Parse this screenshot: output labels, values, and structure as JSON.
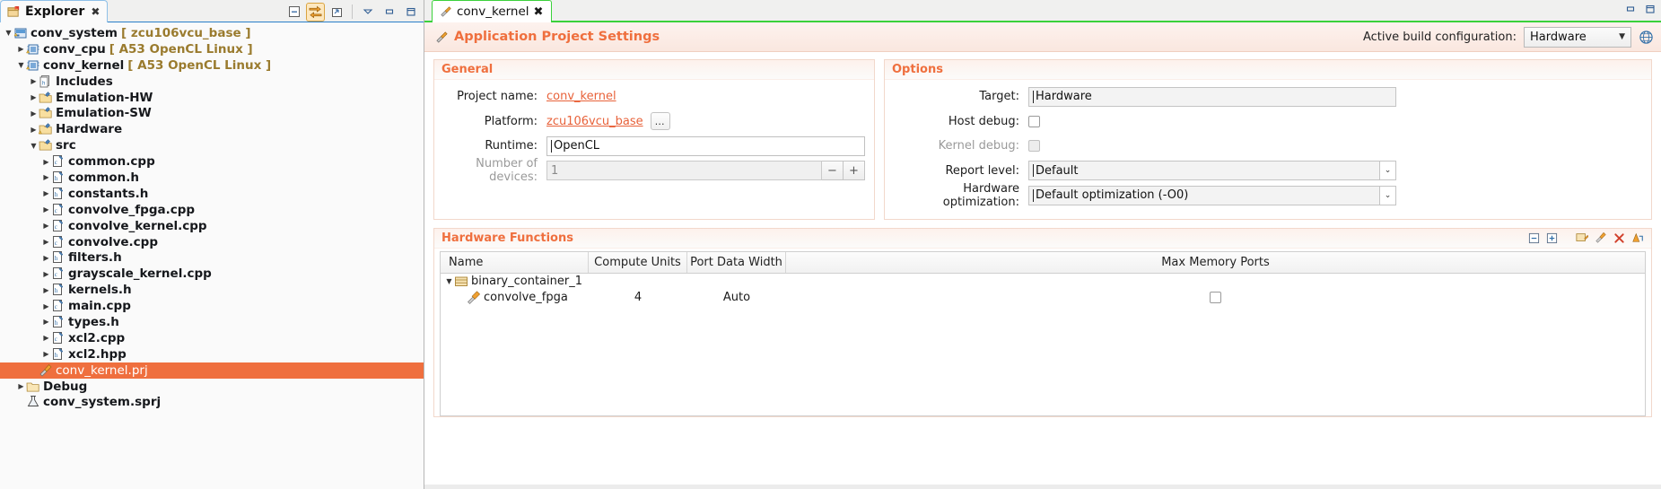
{
  "explorer": {
    "tab_label": "Explorer",
    "tab_close": "✖",
    "toolbar": [
      {
        "name": "collapse-all-icon",
        "glyph": "⊟"
      },
      {
        "name": "link-with-editor-icon",
        "glyph": "⇆"
      },
      {
        "name": "restore-icon",
        "glyph": "⇱"
      },
      {
        "name": "view-menu-icon",
        "glyph": "▽"
      },
      {
        "name": "minimize-icon",
        "glyph": "▭"
      },
      {
        "name": "maximize-icon",
        "glyph": "❐"
      }
    ],
    "tree": [
      {
        "indent": 0,
        "arrow": "▼",
        "icon": "system-project-icon",
        "name": "conv_system",
        "meta": "[ zcu106vcu_base ]",
        "selected": false
      },
      {
        "indent": 1,
        "arrow": "▶",
        "icon": "cpu-project-icon",
        "name": "conv_cpu",
        "meta": "[ A53 OpenCL Linux ]",
        "selected": false
      },
      {
        "indent": 1,
        "arrow": "▼",
        "icon": "cpu-project-icon",
        "name": "conv_kernel",
        "meta": "[ A53 OpenCL Linux ]",
        "selected": false
      },
      {
        "indent": 2,
        "arrow": "▶",
        "icon": "includes-icon",
        "name": "Includes",
        "meta": "",
        "selected": false
      },
      {
        "indent": 2,
        "arrow": "▶",
        "icon": "folder-build-icon",
        "name": "Emulation-HW",
        "meta": "",
        "selected": false
      },
      {
        "indent": 2,
        "arrow": "▶",
        "icon": "folder-build-icon",
        "name": "Emulation-SW",
        "meta": "",
        "selected": false
      },
      {
        "indent": 2,
        "arrow": "▶",
        "icon": "folder-build-warning-icon",
        "name": "Hardware",
        "meta": "",
        "selected": false
      },
      {
        "indent": 2,
        "arrow": "▼",
        "icon": "folder-src-icon",
        "name": "src",
        "meta": "",
        "selected": false
      },
      {
        "indent": 3,
        "arrow": "▶",
        "icon": "cpp-file-icon",
        "name": "common.cpp",
        "meta": "",
        "selected": false
      },
      {
        "indent": 3,
        "arrow": "▶",
        "icon": "h-file-icon",
        "name": "common.h",
        "meta": "",
        "selected": false
      },
      {
        "indent": 3,
        "arrow": "▶",
        "icon": "h-file-icon",
        "name": "constants.h",
        "meta": "",
        "selected": false
      },
      {
        "indent": 3,
        "arrow": "▶",
        "icon": "cpp-file-icon",
        "name": "convolve_fpga.cpp",
        "meta": "",
        "selected": false
      },
      {
        "indent": 3,
        "arrow": "▶",
        "icon": "cpp-file-icon",
        "name": "convolve_kernel.cpp",
        "meta": "",
        "selected": false
      },
      {
        "indent": 3,
        "arrow": "▶",
        "icon": "cpp-file-icon",
        "name": "convolve.cpp",
        "meta": "",
        "selected": false
      },
      {
        "indent": 3,
        "arrow": "▶",
        "icon": "h-file-icon",
        "name": "filters.h",
        "meta": "",
        "selected": false
      },
      {
        "indent": 3,
        "arrow": "▶",
        "icon": "cpp-file-icon",
        "name": "grayscale_kernel.cpp",
        "meta": "",
        "selected": false
      },
      {
        "indent": 3,
        "arrow": "▶",
        "icon": "h-file-icon",
        "name": "kernels.h",
        "meta": "",
        "selected": false
      },
      {
        "indent": 3,
        "arrow": "▶",
        "icon": "cpp-file-icon",
        "name": "main.cpp",
        "meta": "",
        "selected": false
      },
      {
        "indent": 3,
        "arrow": "▶",
        "icon": "h-file-icon",
        "name": "types.h",
        "meta": "",
        "selected": false
      },
      {
        "indent": 3,
        "arrow": "▶",
        "icon": "cpp-file-icon",
        "name": "xcl2.cpp",
        "meta": "",
        "selected": false
      },
      {
        "indent": 3,
        "arrow": "▶",
        "icon": "h-file-icon",
        "name": "xcl2.hpp",
        "meta": "",
        "selected": false
      },
      {
        "indent": 2,
        "arrow": "",
        "icon": "prj-file-icon",
        "name": "conv_kernel.prj",
        "meta": "",
        "selected": true
      },
      {
        "indent": 1,
        "arrow": "▶",
        "icon": "folder-plain-icon",
        "name": "Debug",
        "meta": "",
        "selected": false
      },
      {
        "indent": 1,
        "arrow": "",
        "icon": "sprj-file-icon",
        "name": "conv_system.sprj",
        "meta": "",
        "selected": false
      }
    ]
  },
  "editor": {
    "tab_label": "conv_kernel",
    "tab_close": "✖",
    "window_buttons": [
      {
        "name": "minimize-icon",
        "glyph": "▭"
      },
      {
        "name": "maximize-icon",
        "glyph": "❐"
      }
    ],
    "title": "Application Project Settings",
    "active_build_label": "Active build configuration:",
    "active_build_value": "Hardware",
    "active_build_caret": "▼",
    "general": {
      "heading": "General",
      "project_name_label": "Project name:",
      "project_name_value": "conv_kernel",
      "platform_label": "Platform:",
      "platform_value": "zcu106vcu_base",
      "platform_browse": "…",
      "runtime_label": "Runtime:",
      "runtime_value": "OpenCL",
      "devices_label": "Number of devices:",
      "devices_value": "1",
      "devices_minus": "−",
      "devices_plus": "+"
    },
    "options": {
      "heading": "Options",
      "target_label": "Target:",
      "target_value": "Hardware",
      "host_debug_label": "Host debug:",
      "kernel_debug_label": "Kernel debug:",
      "report_level_label": "Report level:",
      "report_level_value": "Default",
      "hw_opt_label": "Hardware optimization:",
      "hw_opt_value": "Default optimization (-O0)"
    },
    "hardware_functions": {
      "heading": "Hardware Functions",
      "toolbar": [
        {
          "name": "collapse-all-icon",
          "glyph": "⊟"
        },
        {
          "name": "expand-all-icon",
          "glyph": "⊞"
        },
        {
          "name": "edit-binary-container-icon",
          "glyph": "✎"
        },
        {
          "name": "add-hardware-function-icon",
          "glyph": "🖉"
        },
        {
          "name": "remove-hardware-function-icon",
          "glyph": "✖"
        },
        {
          "name": "clock-settings-icon",
          "glyph": "⌁"
        }
      ],
      "columns": [
        "Name",
        "Compute Units",
        "Port Data Width",
        "Max Memory Ports"
      ],
      "rows": [
        {
          "indent": 0,
          "twisty": "▼",
          "icon": "binary-container-icon",
          "name": "binary_container_1",
          "compute_units": "",
          "port_data_width": "",
          "max_memory_ports": null
        },
        {
          "indent": 1,
          "twisty": "",
          "icon": "hardware-function-icon",
          "name": "convolve_fpga",
          "compute_units": "4",
          "port_data_width": "Auto",
          "max_memory_ports": false
        }
      ]
    }
  },
  "colors": {
    "accent_orange": "#ef6f3e",
    "selection_orange": "#ef6f3e",
    "tab_green": "#3bd13b",
    "tab_blue": "#2a7fc9",
    "meta_gold": "#9a7b2e"
  }
}
